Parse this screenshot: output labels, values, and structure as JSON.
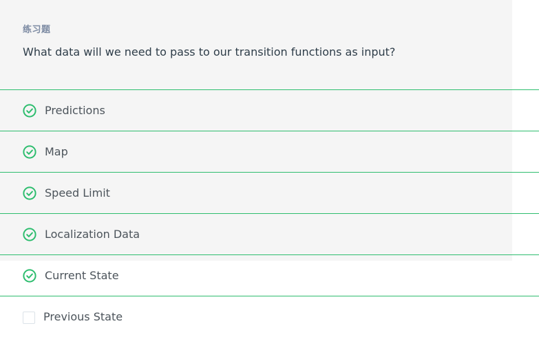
{
  "quiz": {
    "eyebrow": "练习题",
    "question": "What data will we need to pass to our transition functions as input?",
    "accent_color": "#2dbd6e",
    "options": [
      {
        "label": "Predictions",
        "checked": true
      },
      {
        "label": "Map",
        "checked": true
      },
      {
        "label": "Speed Limit",
        "checked": true
      },
      {
        "label": "Localization Data",
        "checked": true
      },
      {
        "label": "Current State",
        "checked": true
      },
      {
        "label": "Previous State",
        "checked": false
      }
    ]
  },
  "icons": {
    "checked": "check-circle-icon",
    "unchecked": "empty-checkbox-icon"
  }
}
